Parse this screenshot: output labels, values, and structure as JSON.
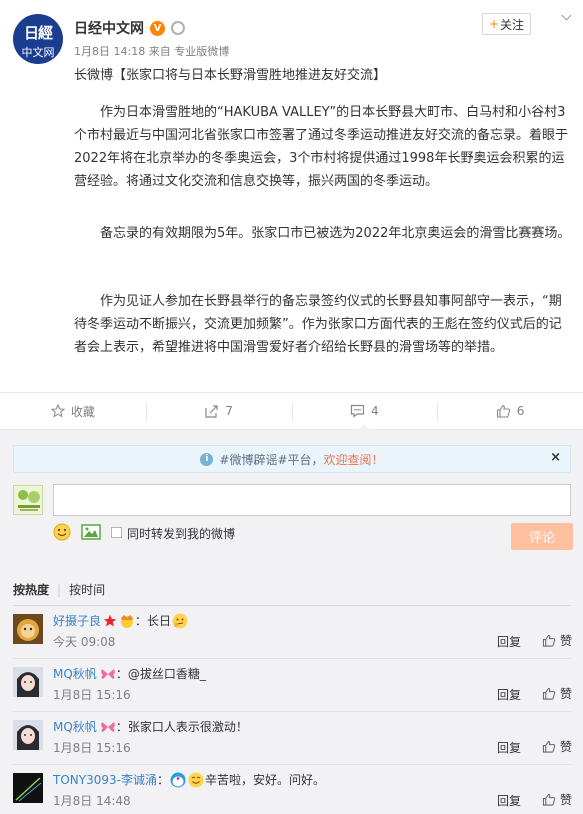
{
  "post": {
    "author": "日经中文网",
    "avatar_text_top": "日經",
    "avatar_text_bottom": "中文网",
    "date": "1月8日 14:18",
    "source_prefix": "来自",
    "source": "专业版微博",
    "follow_label": "关注",
    "long_title": "长微博【张家口将与日本长野滑雪胜地推进友好交流】",
    "paragraphs": [
      "作为日本滑雪胜地的“HAKUBA VALLEY”的日本长野县大町市、白马村和小谷村3个市村最近与中国河北省张家口市签署了通过冬季运动推进友好交流的备忘录。着眼于2022年将在北京举办的冬季奥运会，3个市村将提供通过1998年长野奥运会积累的运营经验。将通过文化交流和信息交换等，振兴两国的冬季运动。",
      "备忘录的有效期限为5年。张家口市已被选为2022年北京奥运会的滑雪比赛赛场。",
      "作为见证人参加在长野县举行的备忘录签约仪式的长野县知事阿部守一表示，“期待冬季运动不断振兴，交流更加频繁”。作为张家口方面代表的王彪在签约仪式后的记者会上表示，希望推进将中国滑雪爱好者介绍给长野县的滑雪场等的举措。"
    ]
  },
  "actions": {
    "favorite_label": "收藏",
    "forward_count": "7",
    "comment_count": "4",
    "like_count": "6"
  },
  "comment_box": {
    "notice_prefix": "#微博辟谣#平台，",
    "notice_link": "欢迎查阅！",
    "notice_close": "×",
    "forward_label": "同时转发到我的微博",
    "submit_label": "评论"
  },
  "sort": {
    "hot": "按热度",
    "time": "按时间"
  },
  "comments": [
    {
      "name": "好摄子良",
      "text": "：长日",
      "time": "今天 09:08",
      "reply": "回复",
      "like": "赞"
    },
    {
      "name": "MQ秋帆",
      "text": "：@拔丝口香糖_",
      "time": "1月8日 15:16",
      "reply": "回复",
      "like": "赞"
    },
    {
      "name": "MQ秋帆",
      "text": "：张家口人表示很激动！",
      "time": "1月8日 15:16",
      "reply": "回复",
      "like": "赞"
    },
    {
      "name": "TONY3093-李诚涌",
      "text": "辛苦啦，安好。问好。",
      "time": "1月8日 14:48",
      "reply": "回复",
      "like": "赞"
    }
  ],
  "colors": {
    "accent": "#ff8200",
    "link": "#eb7350",
    "name_blue": "#3b82c4",
    "comment_bg": "#f2f2f5",
    "submit_disabled": "#ffc09f"
  }
}
